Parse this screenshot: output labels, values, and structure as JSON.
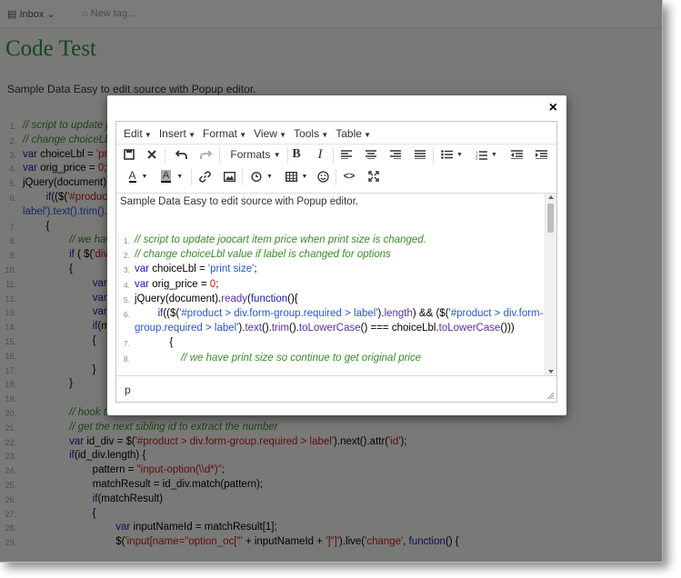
{
  "topbar": {
    "notebook": "Inbox",
    "tag_placeholder": "New tag..."
  },
  "doc": {
    "title": "Code Test",
    "body": "Sample Data Easy to edit source with Popup editor."
  },
  "bg_code": [
    {
      "n": "1.",
      "html": "<span class='c-cm'>// script to update joocart item price when print size is changed.</span>"
    },
    {
      "n": "2.",
      "html": "<span class='c-cm'>// change choiceLbl value if label is changed for options</span>"
    },
    {
      "n": "3.",
      "html": "<span class='c-kw'>var</span> <span class='c-id'>choiceLbl</span> = <span class='c-str'>'print size'</span>;"
    },
    {
      "n": "4.",
      "html": "<span class='c-kw'>var</span> <span class='c-id'>orig_price</span> = <span class='c-str'>0</span>;"
    },
    {
      "n": "5.",
      "html": "<span class='c-id'>jQuery(document).ready(</span><span class='c-kw'>function</span>(){"
    },
    {
      "n": "6.",
      "html": "&nbsp;&nbsp;&nbsp;&nbsp;&nbsp;&nbsp;&nbsp;&nbsp;<span class='c-kw'>if</span>(($(<span class='c-str'>'#product &gt; div.form-group.required &gt;</span>"
    },
    {
      "n": "",
      "html": "<span class='c-bl'>label').text().trim().toLowerCase() === choiceLbl.toLowerCase()))</span>"
    },
    {
      "n": "7.",
      "html": "&nbsp;&nbsp;&nbsp;&nbsp;&nbsp;&nbsp;&nbsp;&nbsp;{"
    },
    {
      "n": "8.",
      "html": "&nbsp;&nbsp;&nbsp;&nbsp;&nbsp;&nbsp;&nbsp;&nbsp;&nbsp;&nbsp;&nbsp;&nbsp;&nbsp;&nbsp;&nbsp;&nbsp;<span class='c-cm'>// we have print size so continue to get original price</span>"
    },
    {
      "n": "9.",
      "html": "&nbsp;&nbsp;&nbsp;&nbsp;&nbsp;&nbsp;&nbsp;&nbsp;&nbsp;&nbsp;&nbsp;&nbsp;&nbsp;&nbsp;&nbsp;&nbsp;<span class='c-kw'>if</span> ( $(<span class='c-str'>'div</span>"
    },
    {
      "n": "10.",
      "html": "&nbsp;&nbsp;&nbsp;&nbsp;&nbsp;&nbsp;&nbsp;&nbsp;&nbsp;&nbsp;&nbsp;&nbsp;&nbsp;&nbsp;&nbsp;&nbsp;{"
    },
    {
      "n": "11.",
      "html": "&nbsp;&nbsp;&nbsp;&nbsp;&nbsp;&nbsp;&nbsp;&nbsp;&nbsp;&nbsp;&nbsp;&nbsp;&nbsp;&nbsp;&nbsp;&nbsp;&nbsp;&nbsp;&nbsp;&nbsp;&nbsp;&nbsp;&nbsp;&nbsp;<span class='c-kw'>var</span>"
    },
    {
      "n": "12.",
      "html": "&nbsp;&nbsp;&nbsp;&nbsp;&nbsp;&nbsp;&nbsp;&nbsp;&nbsp;&nbsp;&nbsp;&nbsp;&nbsp;&nbsp;&nbsp;&nbsp;&nbsp;&nbsp;&nbsp;&nbsp;&nbsp;&nbsp;&nbsp;&nbsp;<span class='c-kw'>var</span>"
    },
    {
      "n": "13.",
      "html": "&nbsp;&nbsp;&nbsp;&nbsp;&nbsp;&nbsp;&nbsp;&nbsp;&nbsp;&nbsp;&nbsp;&nbsp;&nbsp;&nbsp;&nbsp;&nbsp;&nbsp;&nbsp;&nbsp;&nbsp;&nbsp;&nbsp;&nbsp;&nbsp;<span class='c-kw'>var</span>"
    },
    {
      "n": "14.",
      "html": "&nbsp;&nbsp;&nbsp;&nbsp;&nbsp;&nbsp;&nbsp;&nbsp;&nbsp;&nbsp;&nbsp;&nbsp;&nbsp;&nbsp;&nbsp;&nbsp;&nbsp;&nbsp;&nbsp;&nbsp;&nbsp;&nbsp;&nbsp;&nbsp;<span class='c-kw'>if</span>(<span class='c-id'>m</span>"
    },
    {
      "n": "15.",
      "html": "&nbsp;&nbsp;&nbsp;&nbsp;&nbsp;&nbsp;&nbsp;&nbsp;&nbsp;&nbsp;&nbsp;&nbsp;&nbsp;&nbsp;&nbsp;&nbsp;&nbsp;&nbsp;&nbsp;&nbsp;&nbsp;&nbsp;&nbsp;&nbsp;{"
    },
    {
      "n": "16.",
      "html": ""
    },
    {
      "n": "17.",
      "html": "&nbsp;&nbsp;&nbsp;&nbsp;&nbsp;&nbsp;&nbsp;&nbsp;&nbsp;&nbsp;&nbsp;&nbsp;&nbsp;&nbsp;&nbsp;&nbsp;&nbsp;&nbsp;&nbsp;&nbsp;&nbsp;&nbsp;&nbsp;&nbsp;}"
    },
    {
      "n": "18.",
      "html": "&nbsp;&nbsp;&nbsp;&nbsp;&nbsp;&nbsp;&nbsp;&nbsp;&nbsp;&nbsp;&nbsp;&nbsp;&nbsp;&nbsp;&nbsp;&nbsp;}"
    },
    {
      "n": "19.",
      "html": ""
    },
    {
      "n": "20.",
      "html": "&nbsp;&nbsp;&nbsp;&nbsp;&nbsp;&nbsp;&nbsp;&nbsp;&nbsp;&nbsp;&nbsp;&nbsp;&nbsp;&nbsp;&nbsp;&nbsp;<span class='c-cm'>// hook the radio buttons</span>"
    },
    {
      "n": "21.",
      "html": "&nbsp;&nbsp;&nbsp;&nbsp;&nbsp;&nbsp;&nbsp;&nbsp;&nbsp;&nbsp;&nbsp;&nbsp;&nbsp;&nbsp;&nbsp;&nbsp;<span class='c-cm'>// get the next sibling id to extract the number</span>"
    },
    {
      "n": "22.",
      "html": "&nbsp;&nbsp;&nbsp;&nbsp;&nbsp;&nbsp;&nbsp;&nbsp;&nbsp;&nbsp;&nbsp;&nbsp;&nbsp;&nbsp;&nbsp;&nbsp;<span class='c-kw'>var</span> <span class='c-id'>id_div</span> = $(<span class='c-str'>'#product &gt; div.form-group.required &gt; label'</span>).next().<span class='c-id'>attr</span>(<span class='c-str'>'id'</span>);"
    },
    {
      "n": "23.",
      "html": "&nbsp;&nbsp;&nbsp;&nbsp;&nbsp;&nbsp;&nbsp;&nbsp;&nbsp;&nbsp;&nbsp;&nbsp;&nbsp;&nbsp;&nbsp;&nbsp;<span class='c-kw'>if</span>(id_div.length) {"
    },
    {
      "n": "24.",
      "html": "&nbsp;&nbsp;&nbsp;&nbsp;&nbsp;&nbsp;&nbsp;&nbsp;&nbsp;&nbsp;&nbsp;&nbsp;&nbsp;&nbsp;&nbsp;&nbsp;&nbsp;&nbsp;&nbsp;&nbsp;&nbsp;&nbsp;&nbsp;&nbsp;pattern = <span class='c-str'>\"input-option(\\\\d*)\"</span>;"
    },
    {
      "n": "25.",
      "html": "&nbsp;&nbsp;&nbsp;&nbsp;&nbsp;&nbsp;&nbsp;&nbsp;&nbsp;&nbsp;&nbsp;&nbsp;&nbsp;&nbsp;&nbsp;&nbsp;&nbsp;&nbsp;&nbsp;&nbsp;&nbsp;&nbsp;&nbsp;&nbsp;<span class='c-id'>matchResult</span> = id_div.match(pattern);"
    },
    {
      "n": "26.",
      "html": "&nbsp;&nbsp;&nbsp;&nbsp;&nbsp;&nbsp;&nbsp;&nbsp;&nbsp;&nbsp;&nbsp;&nbsp;&nbsp;&nbsp;&nbsp;&nbsp;&nbsp;&nbsp;&nbsp;&nbsp;&nbsp;&nbsp;&nbsp;&nbsp;<span class='c-kw'>if</span>(<span class='c-id'>matchResult</span>)"
    },
    {
      "n": "27.",
      "html": "&nbsp;&nbsp;&nbsp;&nbsp;&nbsp;&nbsp;&nbsp;&nbsp;&nbsp;&nbsp;&nbsp;&nbsp;&nbsp;&nbsp;&nbsp;&nbsp;&nbsp;&nbsp;&nbsp;&nbsp;&nbsp;&nbsp;&nbsp;&nbsp;{"
    },
    {
      "n": "28.",
      "html": "&nbsp;&nbsp;&nbsp;&nbsp;&nbsp;&nbsp;&nbsp;&nbsp;&nbsp;&nbsp;&nbsp;&nbsp;&nbsp;&nbsp;&nbsp;&nbsp;&nbsp;&nbsp;&nbsp;&nbsp;&nbsp;&nbsp;&nbsp;&nbsp;&nbsp;&nbsp;&nbsp;&nbsp;&nbsp;&nbsp;&nbsp;&nbsp;<span class='c-kw'>var</span> <span class='c-id'>inputNameId</span> = <span class='c-id'>matchResult</span>[1];"
    },
    {
      "n": "29.",
      "html": "&nbsp;&nbsp;&nbsp;&nbsp;&nbsp;&nbsp;&nbsp;&nbsp;&nbsp;&nbsp;&nbsp;&nbsp;&nbsp;&nbsp;&nbsp;&nbsp;&nbsp;&nbsp;&nbsp;&nbsp;&nbsp;&nbsp;&nbsp;&nbsp;&nbsp;&nbsp;&nbsp;&nbsp;&nbsp;&nbsp;&nbsp;&nbsp;$(<span class='c-str'>'input[name=\"option_oc[\"'</span> + inputNameId + <span class='c-str'>']\"]'</span>).live(<span class='c-str'>'change'</span>, <span class='c-kw'>function</span>() {"
    }
  ],
  "modal": {
    "close_label": "×",
    "menus": [
      "Edit",
      "Insert",
      "Format",
      "View",
      "Tools",
      "Table"
    ],
    "formats_label": "Formats",
    "intro": "Sample Data Easy to edit source with Popup editor.",
    "status_path": "p",
    "code": [
      {
        "n": "1.",
        "html": "<span class='c-cm'>// script to update joocart item price when print size is changed.</span>"
      },
      {
        "n": "2.",
        "html": "<span class='c-cm'>// change choiceLbl value if label is changed for options</span>"
      },
      {
        "n": "3.",
        "html": "<span class='c-kw'>var</span> <span class='c-id'>choiceLbl</span> = <span class='c-bl'>'print size'</span>;"
      },
      {
        "n": "4.",
        "html": "<span class='c-kw'>var</span> <span class='c-id'>orig_price</span> = <span class='c-str'>0</span>;"
      },
      {
        "n": "5.",
        "html": "<span class='c-id'>jQuery(document).</span><span class='c-fn'>ready</span>(<span class='c-kw'>function</span>(){"
      },
      {
        "n": "6.",
        "html": "&nbsp;&nbsp;&nbsp;&nbsp;&nbsp;&nbsp;&nbsp;&nbsp;<span class='c-kw'>if</span>(($(<span class='c-bl'>'#product &gt; div.form-group.required &gt; label'</span>).<span class='c-fn'>length</span>) &amp;&amp; ($(<span class='c-bl'>'#product &gt; div.form-</span>"
      },
      {
        "n": "",
        "html": "<span class='c-bl'>group.required &gt; label'</span>).<span class='c-fn'>text</span>().<span class='c-fn'>trim</span>().<span class='c-fn'>toLowerCase</span>() === <span class='c-id'>choiceLbl</span>.<span class='c-fn'>toLowerCase</span>()))"
      },
      {
        "n": "7.",
        "html": "&nbsp;&nbsp;&nbsp;&nbsp;&nbsp;&nbsp;&nbsp;&nbsp;&nbsp;&nbsp;&nbsp;&nbsp;{"
      },
      {
        "n": "8.",
        "html": "&nbsp;&nbsp;&nbsp;&nbsp;&nbsp;&nbsp;&nbsp;&nbsp;&nbsp;&nbsp;&nbsp;&nbsp;&nbsp;&nbsp;&nbsp;&nbsp;<span class='c-cm'>// we have print size so continue to get original price</span>"
      }
    ]
  }
}
